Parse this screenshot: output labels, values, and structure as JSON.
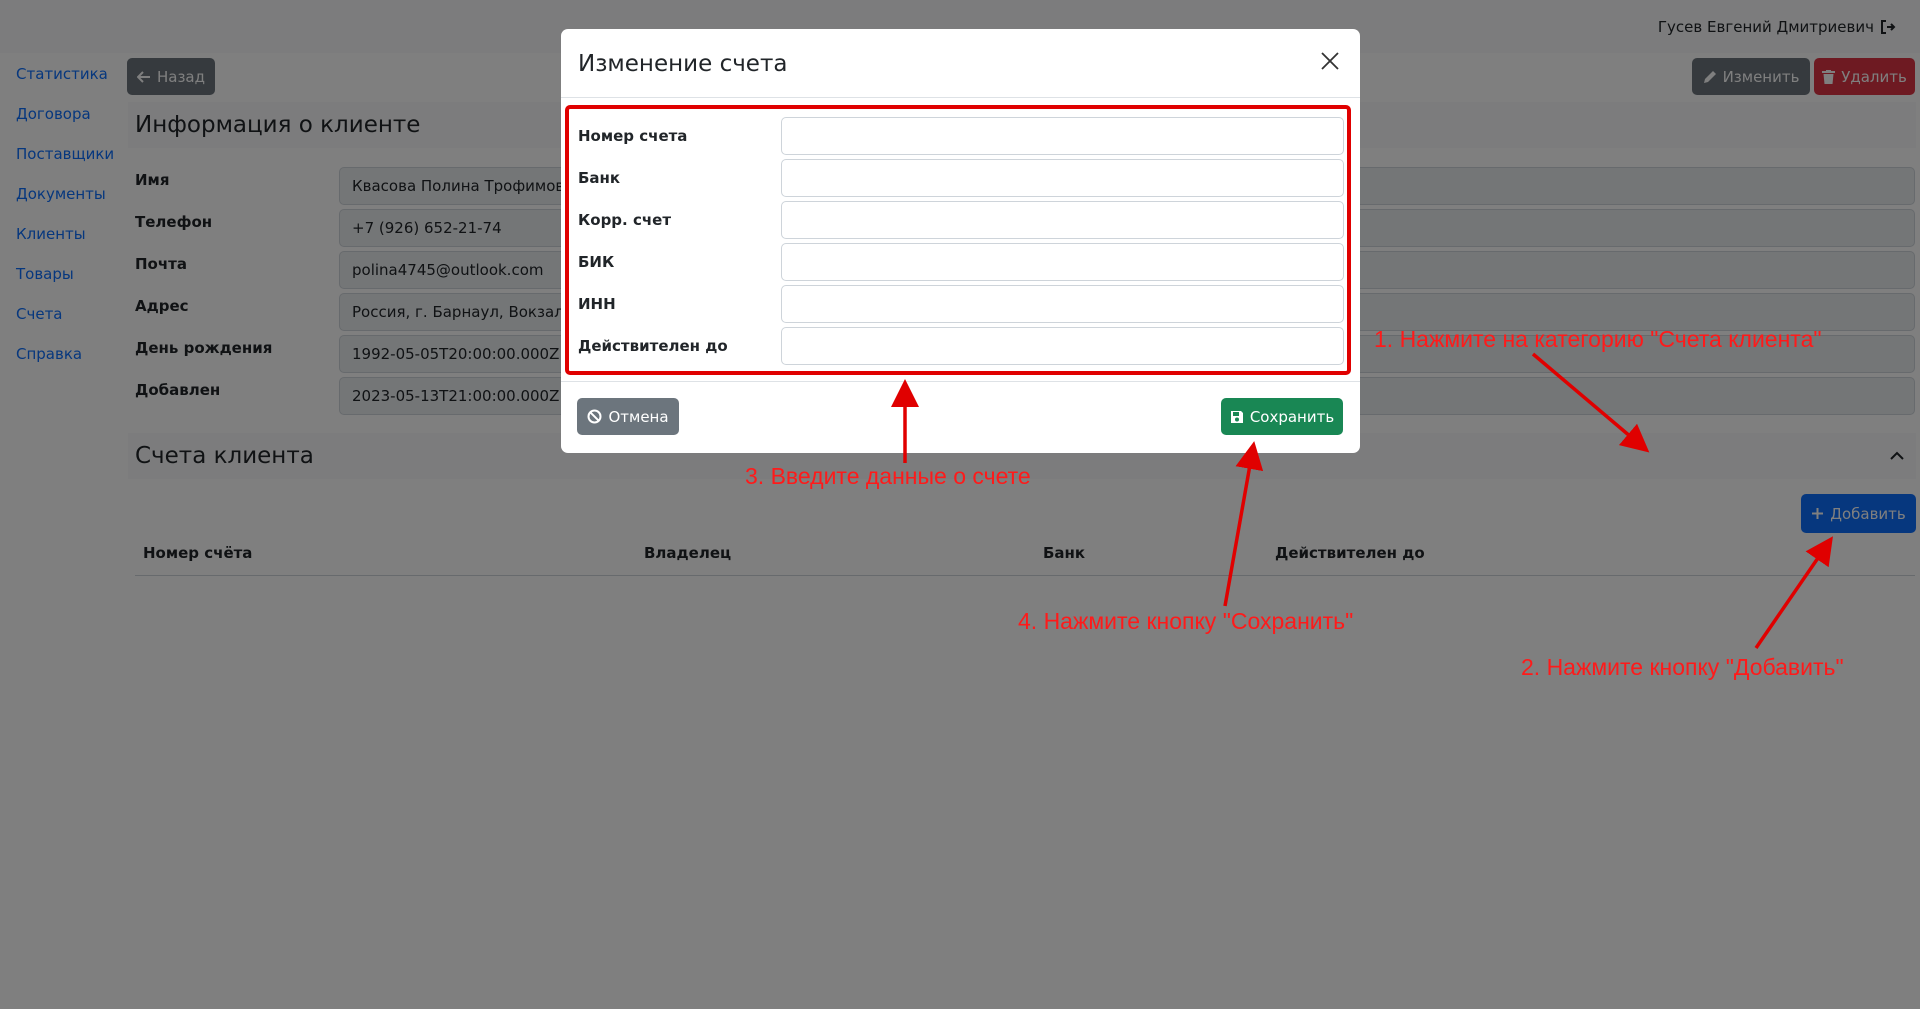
{
  "header": {
    "user_name": "Гусев Евгений Дмитриевич",
    "logout_icon": "sign-out-icon"
  },
  "sidebar": {
    "items": [
      {
        "label": "Статистика"
      },
      {
        "label": "Договора"
      },
      {
        "label": "Поставщики"
      },
      {
        "label": "Документы"
      },
      {
        "label": "Клиенты"
      },
      {
        "label": "Товары"
      },
      {
        "label": "Счета"
      },
      {
        "label": "Справка"
      }
    ]
  },
  "toolbar": {
    "back_label": "Назад",
    "edit_label": "Изменить",
    "delete_label": "Удалить"
  },
  "client_info": {
    "title": "Информация о клиенте",
    "fields": [
      {
        "label": "Имя",
        "value": "Квасова Полина Трофимовна"
      },
      {
        "label": "Телефон",
        "value": "+7 (926) 652-21-74"
      },
      {
        "label": "Почта",
        "value": "polina4745@outlook.com"
      },
      {
        "label": "Адрес",
        "value": "Россия, г. Барнаул, Вокзальная"
      },
      {
        "label": "День рождения",
        "value": "1992-05-05T20:00:00.000Z"
      },
      {
        "label": "Добавлен",
        "value": "2023-05-13T21:00:00.000Z"
      }
    ]
  },
  "accounts": {
    "title": "Счета клиента",
    "add_label": "Добавить",
    "columns": [
      "Номер счёта",
      "Владелец",
      "Банк",
      "Действителен до"
    ]
  },
  "modal": {
    "title": "Изменение счета",
    "fields": [
      {
        "label": "Номер счета",
        "value": ""
      },
      {
        "label": "Банк",
        "value": ""
      },
      {
        "label": "Корр. счет",
        "value": ""
      },
      {
        "label": "БИК",
        "value": ""
      },
      {
        "label": "ИНН",
        "value": ""
      },
      {
        "label": "Действителен до",
        "value": ""
      }
    ],
    "cancel_label": "Отмена",
    "save_label": "Сохранить"
  },
  "annotations": {
    "step1": "1. Нажмите на категорию \"Счета клиента\"",
    "step2": "2. Нажмите кнопку \"Добавить\"",
    "step3": "3. Введите данные о счете",
    "step4": "4. Нажмите кнопку \"Сохранить\"",
    "color": "#ff1a1a"
  },
  "colors": {
    "primary": "#0d6efd",
    "secondary": "#6c757d",
    "danger": "#dc3545",
    "success": "#198754"
  }
}
